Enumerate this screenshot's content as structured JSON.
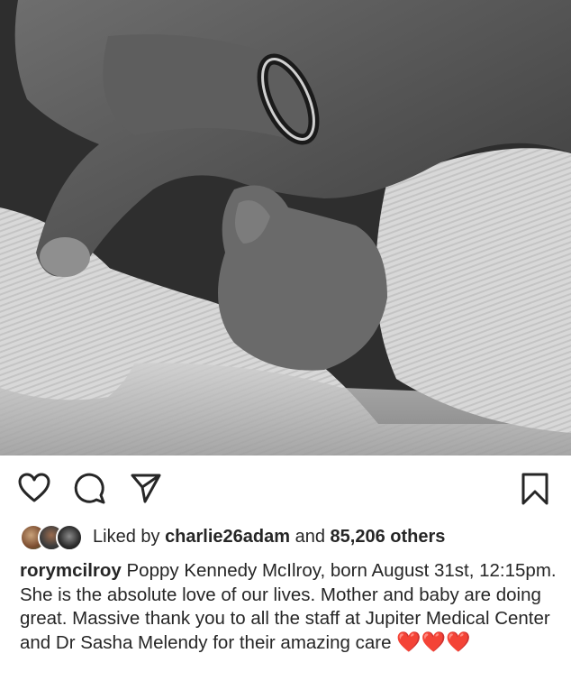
{
  "post": {
    "image_alt": "Black and white photo of an adult hand with a wedding ring holding a newborn baby's hand"
  },
  "actions": {
    "like_icon": "heart-icon",
    "comment_icon": "comment-icon",
    "share_icon": "share-icon",
    "save_icon": "bookmark-icon"
  },
  "likes": {
    "prefix": "Liked by ",
    "user": "charlie26adam",
    "middle": " and ",
    "count": "85,206 others"
  },
  "caption": {
    "username": "rorymcilroy",
    "text": " Poppy Kennedy McIlroy, born August 31st, 12:15pm. She is the absolute love of our lives. Mother and baby are doing great. Massive thank you to all the staff at Jupiter Medical Center and Dr Sasha Melendy for their amazing care ",
    "emojis": "❤️❤️❤️"
  },
  "colors": {
    "text": "#262626",
    "heart": "#e0192d",
    "background": "#ffffff"
  }
}
